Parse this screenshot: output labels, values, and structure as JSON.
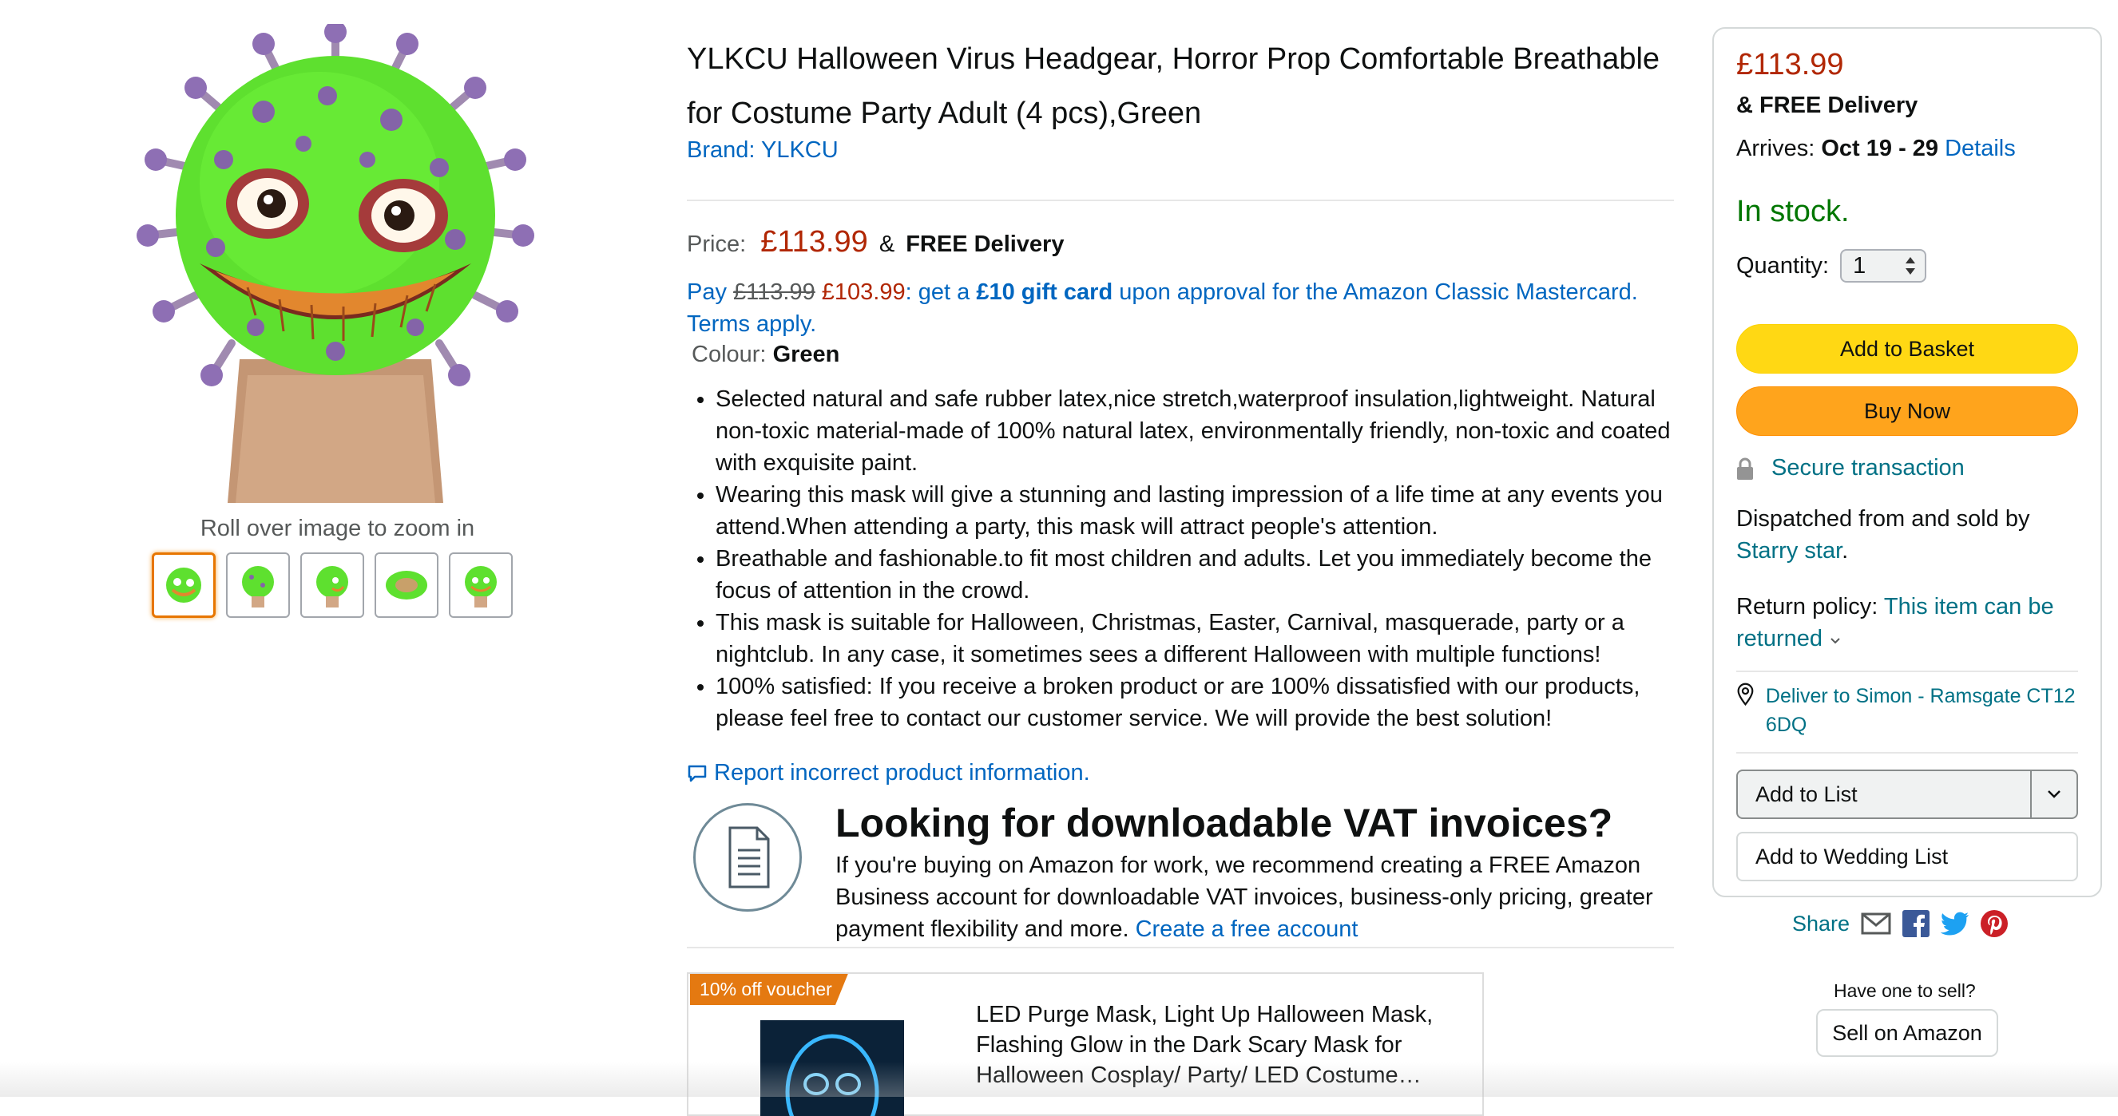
{
  "product": {
    "title": "YLKCU Halloween Virus Headgear, Horror Prop Comfortable Breathable for Costume Party Adult (4 pcs),Green",
    "brand": "Brand: YLKCU",
    "price_label": "Price:",
    "price": "£113.99",
    "delivery_prefix": "&",
    "delivery": "FREE Delivery",
    "pay_prefix": "Pay",
    "pay_old": "£113.99",
    "pay_new": "£103.99",
    "pay_mid": ": get a",
    "pay_gift": "£10 gift card",
    "pay_suffix": "upon approval for the Amazon Classic Mastercard.",
    "terms": "Terms apply.",
    "colour_label": "Colour:",
    "colour_value": "Green",
    "bullets": [
      "Selected natural and safe rubber latex,nice stretch,waterproof insulation,lightweight. Natural non-toxic material-made of 100% natural latex, environmentally friendly, non-toxic and coated with exquisite paint.",
      "Wearing this mask will give a stunning and lasting impression of a life time at any events you attend.When attending a party, this mask will attract people's attention.",
      "Breathable and fashionable.to fit most children and adults. Let you immediately become the focus of attention in the crowd.",
      "This mask is suitable for Halloween, Christmas, Easter, Carnival, masquerade, party or a nightclub. In any case, it sometimes sees a different Halloween with multiple functions!",
      "100% satisfied: If you receive a broken product or are 100% dissatisfied with our products, please feel free to contact our customer service. We will provide the best solution!"
    ],
    "report": "Report incorrect product information."
  },
  "gallery": {
    "zoom_hint": "Roll over image to zoom in",
    "thumb_count": 5
  },
  "vat": {
    "title": "Looking for downloadable VAT invoices?",
    "body": "If you're buying on Amazon for work, we recommend creating a FREE Amazon Business account for downloadable VAT invoices, business-only pricing, greater payment flexibility and more.",
    "link": "Create a free account"
  },
  "voucher": {
    "badge": "10% off voucher",
    "text": "LED Purge Mask, Light Up Halloween Mask, Flashing Glow in the Dark Scary Mask for Halloween Cosplay/ Party/ LED Costume…"
  },
  "buybox": {
    "price": "£113.99",
    "free_prefix": "&",
    "free_delivery": "FREE Delivery",
    "arrives_label": "Arrives:",
    "arrives_dates": "Oct 19 - 29",
    "details": "Details",
    "stock": "In stock.",
    "quantity_label": "Quantity:",
    "quantity_value": "1",
    "add_to_basket": "Add to Basket",
    "buy_now": "Buy Now",
    "secure": "Secure transaction",
    "dispatch_text": "Dispatched from and sold by",
    "seller": "Starry star",
    "seller_suffix": ".",
    "return_label": "Return policy:",
    "return_link": "This item can be returned",
    "deliver_to": "Deliver to Simon - Ramsgate CT12 6DQ",
    "add_to_list": "Add to List",
    "add_to_wedding": "Add to Wedding List",
    "share": "Share",
    "have_one": "Have one to sell?",
    "sell": "Sell on Amazon"
  },
  "colors": {
    "price": "#b12704",
    "link": "#0066c0",
    "stock": "#007600",
    "add_basket": "#ffd814",
    "buy_now": "#ffa41c",
    "voucher_badge": "#e47911",
    "selected_thumb": "#e77600"
  }
}
